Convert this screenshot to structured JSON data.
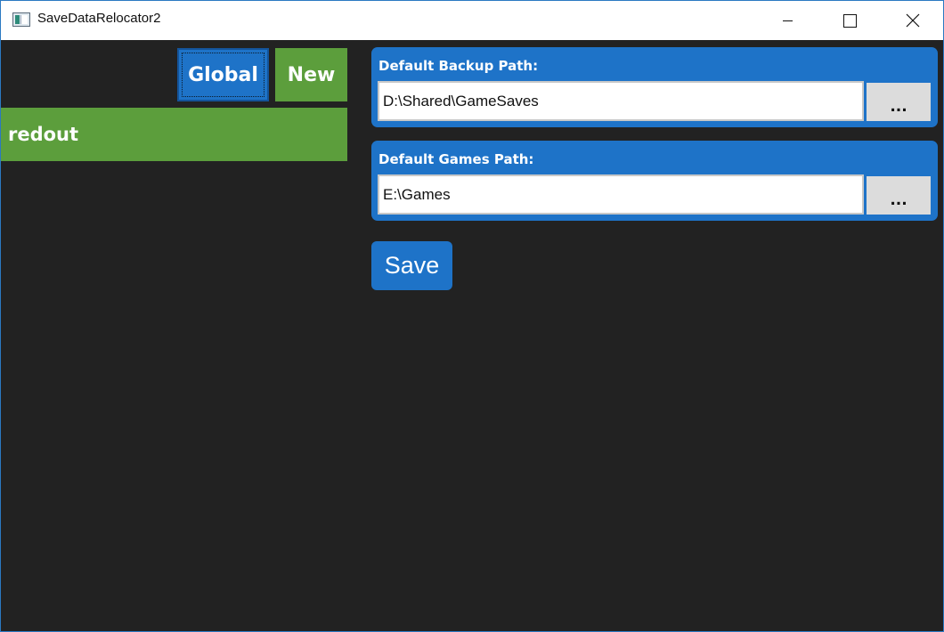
{
  "window": {
    "title": "SaveDataRelocator2"
  },
  "sidebar": {
    "global_label": "Global",
    "new_label": "New",
    "games": [
      {
        "label": "redout"
      }
    ]
  },
  "settings": {
    "backup_path": {
      "label": "Default Backup Path:",
      "value": "D:\\Shared\\GameSaves",
      "browse_label": "..."
    },
    "games_path": {
      "label": "Default Games Path:",
      "value": "E:\\Games",
      "browse_label": "..."
    },
    "save_label": "Save"
  },
  "colors": {
    "accent_blue": "#1e73c8",
    "accent_green": "#5c9e3c",
    "background": "#222222"
  }
}
